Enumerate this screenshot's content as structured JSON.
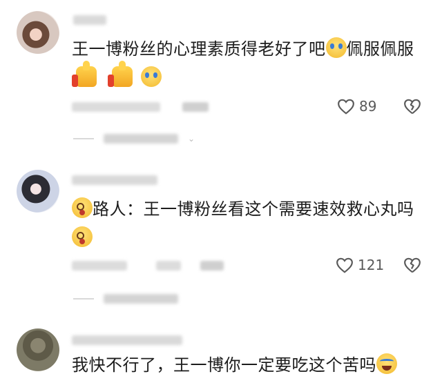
{
  "comments": [
    {
      "text_line1": "王一博粉丝的心理素质得老好了吧",
      "text_line1_tail": "佩服佩服",
      "likes": "89"
    },
    {
      "text_line1": "路人：王一博粉丝看这个需要速效救心丸吗",
      "likes": "121"
    },
    {
      "text_line1": "我快不行了，王一博你一定要吃这个苦吗"
    }
  ],
  "icons": {
    "like": "heart-outline-icon",
    "dislike": "broken-heart-icon",
    "emoji_cry": "crying-laughing-emoji",
    "emoji_thumb": "thumbs-up-emoji",
    "emoji_dizzy": "dizzy-face-emoji",
    "emoji_sob": "loudly-crying-emoji"
  },
  "colors": {
    "text": "#1c1c1c",
    "meta": "#dcdcdc",
    "icon": "#5a5a5a"
  }
}
